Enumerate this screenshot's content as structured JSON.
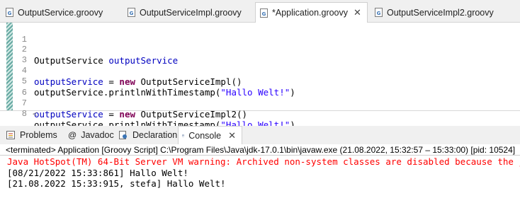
{
  "editor_tabs": [
    {
      "label": "OutputService.groovy",
      "icon": "groovy-file-icon",
      "active": false
    },
    {
      "label": "OutputServiceImpl.groovy",
      "icon": "groovy-file-icon",
      "active": false
    },
    {
      "label": "*Application.groovy",
      "icon": "groovy-file-icon",
      "active": true,
      "close": "✕"
    },
    {
      "label": "OutputServiceImpl2.groovy",
      "icon": "groovy-file-icon",
      "active": false
    }
  ],
  "editor": {
    "lines": [
      {
        "num": "1"
      },
      {
        "num": "2",
        "type": "OutputService",
        "var": "outputService"
      },
      {
        "num": "3"
      },
      {
        "num": "4",
        "var": "outputService",
        "op": " = ",
        "kw": "new",
        "rest": " OutputServiceImpl()"
      },
      {
        "num": "5",
        "pre": "outputService.printlnWithTimestamp(",
        "str": "\"Hallo Welt!\"",
        "post": ")"
      },
      {
        "num": "6"
      },
      {
        "num": "7",
        "var": "outputService",
        "op": " = ",
        "kw": "new",
        "rest": " OutputServiceImpl2()"
      },
      {
        "num": "8",
        "pre": "outputService.printlnWithTimestamp(",
        "str": "\"Hallo Welt!\"",
        "post": ")"
      }
    ],
    "scroll_left_glyph": "<"
  },
  "view_tabs": [
    {
      "label": "Problems",
      "icon": "problems-icon"
    },
    {
      "label": "Javadoc",
      "icon": "at-sign-icon",
      "glyph": "@"
    },
    {
      "label": "Declaration",
      "icon": "declaration-icon"
    },
    {
      "label": "Console",
      "icon": "console-icon",
      "active": true,
      "close": "✕"
    }
  ],
  "console": {
    "header": "<terminated> Application [Groovy Script] C:\\Program Files\\Java\\jdk-17.0.1\\bin\\javaw.exe  (21.08.2022, 15:32:57 – 15:33:00) [pid: 10524]",
    "lines": [
      {
        "text": "Java HotSpot(TM) 64-Bit Server VM warning: Archived non-system classes are disabled because the java.sy",
        "error": true
      },
      {
        "text": "[08/21/2022 15:33:861] Hallo Welt!",
        "error": false
      },
      {
        "text": "[21.08.2022 15:33:915, stefa] Hallo Welt!",
        "error": false
      }
    ]
  },
  "colors": {
    "keyword": "#7f0055",
    "variable": "#0000c0",
    "string": "#2a00ff",
    "stderr": "#ff0000"
  }
}
